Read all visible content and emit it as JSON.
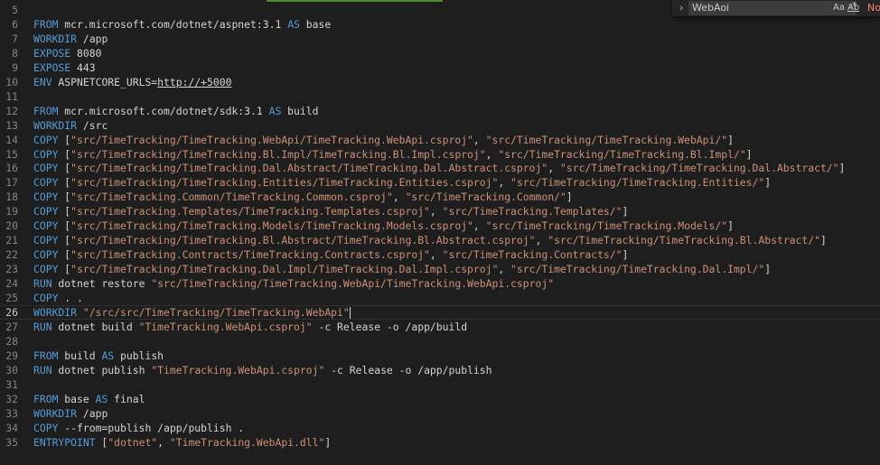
{
  "find_widget": {
    "query": "WebAoi",
    "match_case_label": "Aa",
    "whole_word_label": "Ab",
    "regex_label": ".*",
    "result_label": "No"
  },
  "editor": {
    "current_line": "26",
    "lines": [
      {
        "num": "5",
        "code": ""
      },
      {
        "num": "6",
        "code": "FROM mcr.microsoft.com/dotnet/aspnet:3.1 AS base"
      },
      {
        "num": "7",
        "code": "WORKDIR /app"
      },
      {
        "num": "8",
        "code": "EXPOSE 8080"
      },
      {
        "num": "9",
        "code": "EXPOSE 443"
      },
      {
        "num": "10",
        "code": "ENV ASPNETCORE_URLS=http://+5000"
      },
      {
        "num": "11",
        "code": ""
      },
      {
        "num": "12",
        "code": "FROM mcr.microsoft.com/dotnet/sdk:3.1 AS build"
      },
      {
        "num": "13",
        "code": "WORKDIR /src"
      },
      {
        "num": "14",
        "code": "COPY [\"src/TimeTracking/TimeTracking.WebApi/TimeTracking.WebApi.csproj\", \"src/TimeTracking/TimeTracking.WebApi/\"]"
      },
      {
        "num": "15",
        "code": "COPY [\"src/TimeTracking/TimeTracking.Bl.Impl/TimeTracking.Bl.Impl.csproj\", \"src/TimeTracking/TimeTracking.Bl.Impl/\"]"
      },
      {
        "num": "16",
        "code": "COPY [\"src/TimeTracking/TimeTracking.Dal.Abstract/TimeTracking.Dal.Abstract.csproj\", \"src/TimeTracking/TimeTracking.Dal.Abstract/\"]"
      },
      {
        "num": "17",
        "code": "COPY [\"src/TimeTracking/TimeTracking.Entities/TimeTracking.Entities.csproj\", \"src/TimeTracking/TimeTracking.Entities/\"]"
      },
      {
        "num": "18",
        "code": "COPY [\"src/TimeTracking.Common/TimeTracking.Common.csproj\", \"src/TimeTracking.Common/\"]"
      },
      {
        "num": "19",
        "code": "COPY [\"src/TimeTracking.Templates/TimeTracking.Templates.csproj\", \"src/TimeTracking.Templates/\"]"
      },
      {
        "num": "20",
        "code": "COPY [\"src/TimeTracking/TimeTracking.Models/TimeTracking.Models.csproj\", \"src/TimeTracking/TimeTracking.Models/\"]"
      },
      {
        "num": "21",
        "code": "COPY [\"src/TimeTracking/TimeTracking.Bl.Abstract/TimeTracking.Bl.Abstract.csproj\", \"src/TimeTracking/TimeTracking.Bl.Abstract/\"]"
      },
      {
        "num": "22",
        "code": "COPY [\"src/TimeTracking.Contracts/TimeTracking.Contracts.csproj\", \"src/TimeTracking.Contracts/\"]"
      },
      {
        "num": "23",
        "code": "COPY [\"src/TimeTracking/TimeTracking.Dal.Impl/TimeTracking.Dal.Impl.csproj\", \"src/TimeTracking/TimeTracking.Dal.Impl/\"]"
      },
      {
        "num": "24",
        "code": "RUN dotnet restore \"src/TimeTracking/TimeTracking.WebApi/TimeTracking.WebApi.csproj\""
      },
      {
        "num": "25",
        "code": "COPY . ."
      },
      {
        "num": "26",
        "code": "WORKDIR \"/src/src/TimeTracking/TimeTracking.WebApi\""
      },
      {
        "num": "27",
        "code": "RUN dotnet build \"TimeTracking.WebApi.csproj\" -c Release -o /app/build"
      },
      {
        "num": "28",
        "code": ""
      },
      {
        "num": "29",
        "code": "FROM build AS publish"
      },
      {
        "num": "30",
        "code": "RUN dotnet publish \"TimeTracking.WebApi.csproj\" -c Release -o /app/publish"
      },
      {
        "num": "31",
        "code": ""
      },
      {
        "num": "32",
        "code": "FROM base AS final"
      },
      {
        "num": "33",
        "code": "WORKDIR /app"
      },
      {
        "num": "34",
        "code": "COPY --from=publish /app/publish ."
      },
      {
        "num": "35",
        "code": "ENTRYPOINT [\"dotnet\", \"TimeTracking.WebApi.dll\"]"
      }
    ]
  },
  "colors": {
    "background": "#1e1e1e",
    "keyword": "#569cd6",
    "string": "#ce9178",
    "text": "#d4d4d4",
    "line_number": "#858585"
  }
}
